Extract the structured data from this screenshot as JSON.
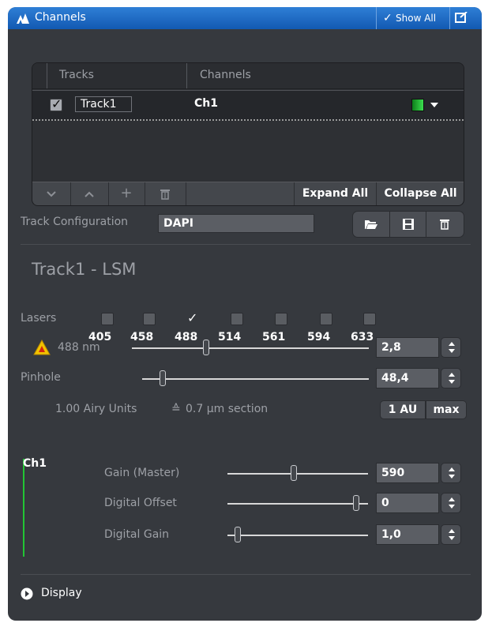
{
  "panel": {
    "title": "Channels",
    "show_all_label": "Show All"
  },
  "tracks_table": {
    "col_tracks": "Tracks",
    "col_channels": "Channels",
    "rows": [
      {
        "checked": true,
        "track": "Track1",
        "channel": "Ch1",
        "channel_color": "#22c534"
      }
    ],
    "footer": {
      "down": "⌄",
      "up": "⌃",
      "add": "+",
      "delete": "🗑",
      "expand_all": "Expand All",
      "collapse_all": "Collapse All"
    }
  },
  "track_config": {
    "label": "Track Configuration",
    "value": "DAPI"
  },
  "section_title": "Track1 - LSM",
  "lasers": {
    "label": "Lasers",
    "items": [
      {
        "wavelength": "405",
        "checked": false
      },
      {
        "wavelength": "458",
        "checked": false
      },
      {
        "wavelength": "488",
        "checked": true
      },
      {
        "wavelength": "514",
        "checked": false
      },
      {
        "wavelength": "561",
        "checked": false
      },
      {
        "wavelength": "594",
        "checked": false
      },
      {
        "wavelength": "633",
        "checked": false
      }
    ]
  },
  "laser_488": {
    "label": "488 nm",
    "value": "2,8",
    "slider_fraction": 0.3
  },
  "pinhole": {
    "label": "Pinhole",
    "value": "48,4",
    "slider_fraction": 0.09,
    "airy_units": "1.00 Airy Units",
    "eject_symbol": "≙",
    "section": "0.7 µm section",
    "btn_1au": "1 AU",
    "btn_max": "max"
  },
  "channel": {
    "name": "Ch1",
    "color": "#22c534",
    "controls": [
      {
        "label": "Gain (Master)",
        "value": "590",
        "slider_fraction": 0.47
      },
      {
        "label": "Digital Offset",
        "value": "0",
        "slider_fraction": 0.92
      },
      {
        "label": "Digital Gain",
        "value": "1,0",
        "slider_fraction": 0.04
      }
    ]
  },
  "display": {
    "label": "Display"
  },
  "colors": {
    "titlebar": "#1a66c1",
    "panel_bg": "#36393e",
    "warning": "#f2c300"
  }
}
